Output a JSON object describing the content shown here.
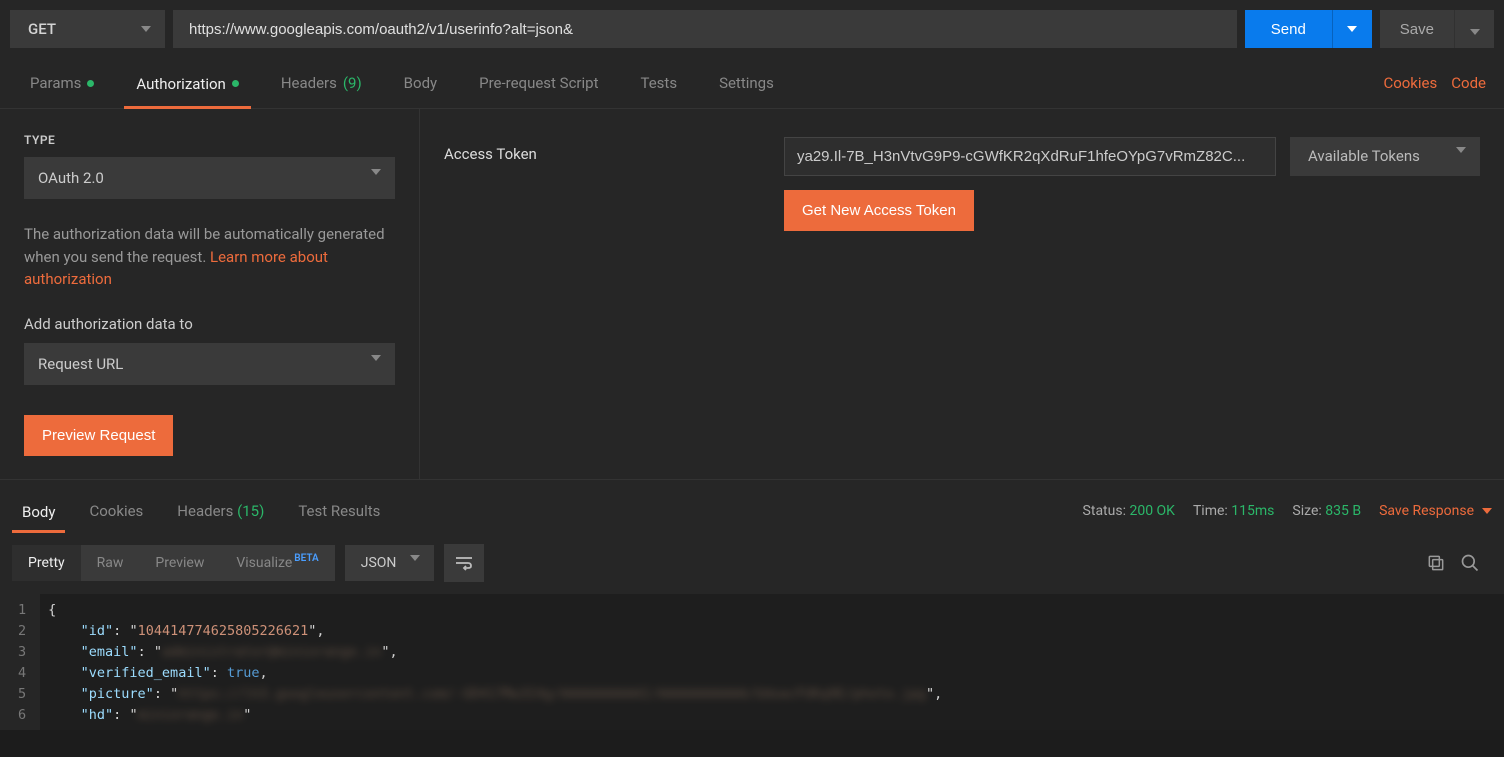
{
  "request": {
    "method": "GET",
    "url": "https://www.googleapis.com/oauth2/v1/userinfo?alt=json&",
    "sendLabel": "Send",
    "saveLabel": "Save"
  },
  "tabs": {
    "params": "Params",
    "authorization": "Authorization",
    "headers": "Headers",
    "headersCount": "(9)",
    "body": "Body",
    "prerequest": "Pre-request Script",
    "tests": "Tests",
    "settings": "Settings",
    "cookies": "Cookies",
    "code": "Code"
  },
  "auth": {
    "typeLabel": "TYPE",
    "typeValue": "OAuth 2.0",
    "helpText1": "The authorization data will be automatically generated when you send the request. ",
    "helpLink": "Learn more about authorization",
    "addDataLabel": "Add authorization data to",
    "addDataValue": "Request URL",
    "previewBtn": "Preview Request",
    "tokenLabel": "Access Token",
    "tokenValue": "ya29.Il-7B_H3nVtvG9P9-cGWfKR2qXdRuF1hfeOYpG7vRmZ82C...",
    "availTokens": "Available Tokens",
    "getNewBtn": "Get New Access Token"
  },
  "response": {
    "tabs": {
      "body": "Body",
      "cookies": "Cookies",
      "headers": "Headers",
      "headersCount": "(15)",
      "testResults": "Test Results"
    },
    "statusLabel": "Status:",
    "statusValue": "200 OK",
    "timeLabel": "Time:",
    "timeValue": "115ms",
    "sizeLabel": "Size:",
    "sizeValue": "835 B",
    "saveResponse": "Save Response",
    "viewTabs": {
      "pretty": "Pretty",
      "raw": "Raw",
      "preview": "Preview",
      "visualize": "Visualize",
      "beta": "BETA"
    },
    "format": "JSON",
    "jsonLines": [
      {
        "n": 1,
        "raw": "{"
      },
      {
        "n": 2,
        "key": "id",
        "val": "104414774625805226621",
        "type": "str"
      },
      {
        "n": 3,
        "key": "email",
        "val": "administrator@miniorange.in",
        "type": "str",
        "blur": true
      },
      {
        "n": 4,
        "key": "verified_email",
        "val": "true",
        "type": "bool"
      },
      {
        "n": 5,
        "key": "picture",
        "val": "https://lh3.googleusercontent.com/-GD417Mw3I4g/AAAAAAAAAAI/AAAAAAAAAAA/UdoacFUKq9E/photo.jpg",
        "type": "str",
        "blur": true
      },
      {
        "n": 6,
        "key": "hd",
        "val": "miniorange.in",
        "type": "str",
        "blur": true,
        "last": true
      }
    ]
  }
}
